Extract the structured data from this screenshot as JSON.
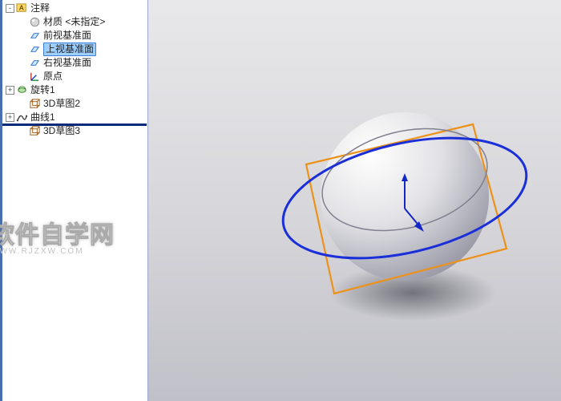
{
  "tree": {
    "items": [
      {
        "label": "注释",
        "icon": "annotation",
        "indent": 0,
        "expander": "-",
        "selected": false
      },
      {
        "label": "材质 <未指定>",
        "icon": "material",
        "indent": 1,
        "expander": "",
        "selected": false
      },
      {
        "label": "前视基准面",
        "icon": "plane",
        "indent": 1,
        "expander": "",
        "selected": false
      },
      {
        "label": "上视基准面",
        "icon": "plane",
        "indent": 1,
        "expander": "",
        "selected": true
      },
      {
        "label": "右视基准面",
        "icon": "plane",
        "indent": 1,
        "expander": "",
        "selected": false
      },
      {
        "label": "原点",
        "icon": "origin",
        "indent": 1,
        "expander": "",
        "selected": false
      },
      {
        "label": "旋转1",
        "icon": "revolve",
        "indent": 0,
        "expander": "+",
        "selected": false
      },
      {
        "label": "3D草图2",
        "icon": "3dsketch",
        "indent": 1,
        "expander": "",
        "selected": false
      },
      {
        "label": "曲线1",
        "icon": "curve",
        "indent": 0,
        "expander": "+",
        "selected": false
      },
      {
        "label": "3D草图3",
        "icon": "3dsketch",
        "indent": 1,
        "expander": "",
        "selected": false
      }
    ]
  },
  "watermark": {
    "title": "软件自学网",
    "url": "WWW.RJZXW.COM"
  },
  "colors": {
    "selection": "#9fcfff",
    "ellipse3d": "#1a2fd8",
    "planeOutline": "#ec921a",
    "sketchSeam": "#808090"
  }
}
